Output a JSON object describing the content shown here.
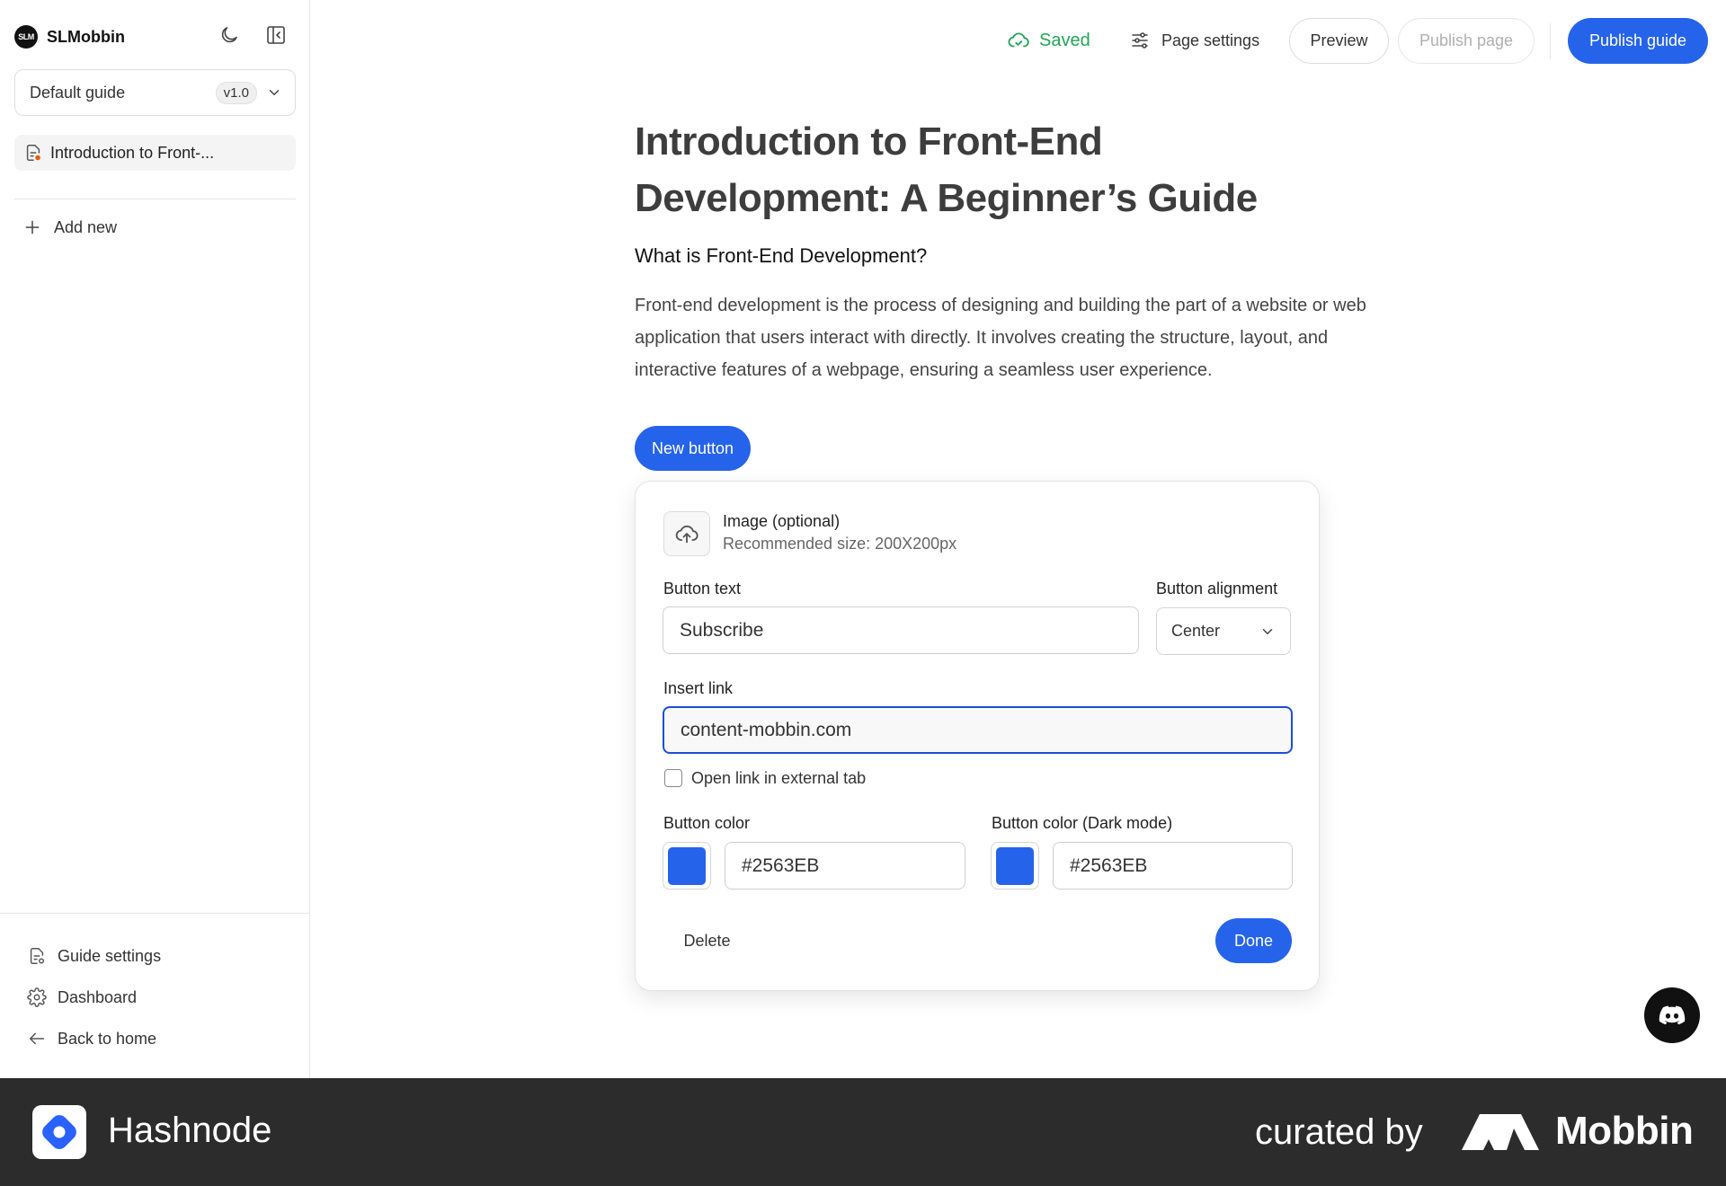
{
  "sidebar": {
    "brand_logo_text": "SLM",
    "brand_name": "SLMobbin",
    "guide_select": {
      "value": "Default guide",
      "version": "v1.0"
    },
    "pages": [
      {
        "label": "Introduction to Front-..."
      }
    ],
    "add_new_label": "Add new",
    "bottom_items": [
      {
        "label": "Guide settings",
        "icon": "guide-settings-icon"
      },
      {
        "label": "Dashboard",
        "icon": "gear-icon"
      },
      {
        "label": "Back to home",
        "icon": "arrow-left-icon"
      }
    ]
  },
  "topbar": {
    "saved_label": "Saved",
    "page_settings_label": "Page settings",
    "preview_label": "Preview",
    "publish_page_label": "Publish page",
    "publish_guide_label": "Publish guide"
  },
  "content": {
    "title": "Introduction to Front-End Development: A Beginner’s Guide",
    "subtitle": "What is Front-End Development?",
    "paragraph": "Front-end development is the process of designing and building the part of a website or web application that users interact with directly. It involves creating the structure, layout, and interactive features of a webpage, ensuring a seamless user experience.",
    "new_button_label": "New button"
  },
  "editor": {
    "image_title": "Image (optional)",
    "image_hint": "Recommended size: 200X200px",
    "button_text_label": "Button text",
    "button_text_value": "Subscribe",
    "alignment_label": "Button alignment",
    "alignment_value": "Center",
    "link_label": "Insert link",
    "link_value": "content-mobbin.com",
    "external_tab_label": "Open link in external tab",
    "external_tab_checked": false,
    "color_label": "Button color",
    "color_value": "#2563EB",
    "color_dark_label": "Button color (Dark mode)",
    "color_dark_value": "#2563EB",
    "delete_label": "Delete",
    "done_label": "Done"
  },
  "footer": {
    "app_name": "Hashnode",
    "curated_by": "curated by",
    "curator": "Mobbin"
  },
  "colors": {
    "accent": "#2563eb",
    "saved_green": "#22a559",
    "footer_bg": "#2c2c2c"
  }
}
